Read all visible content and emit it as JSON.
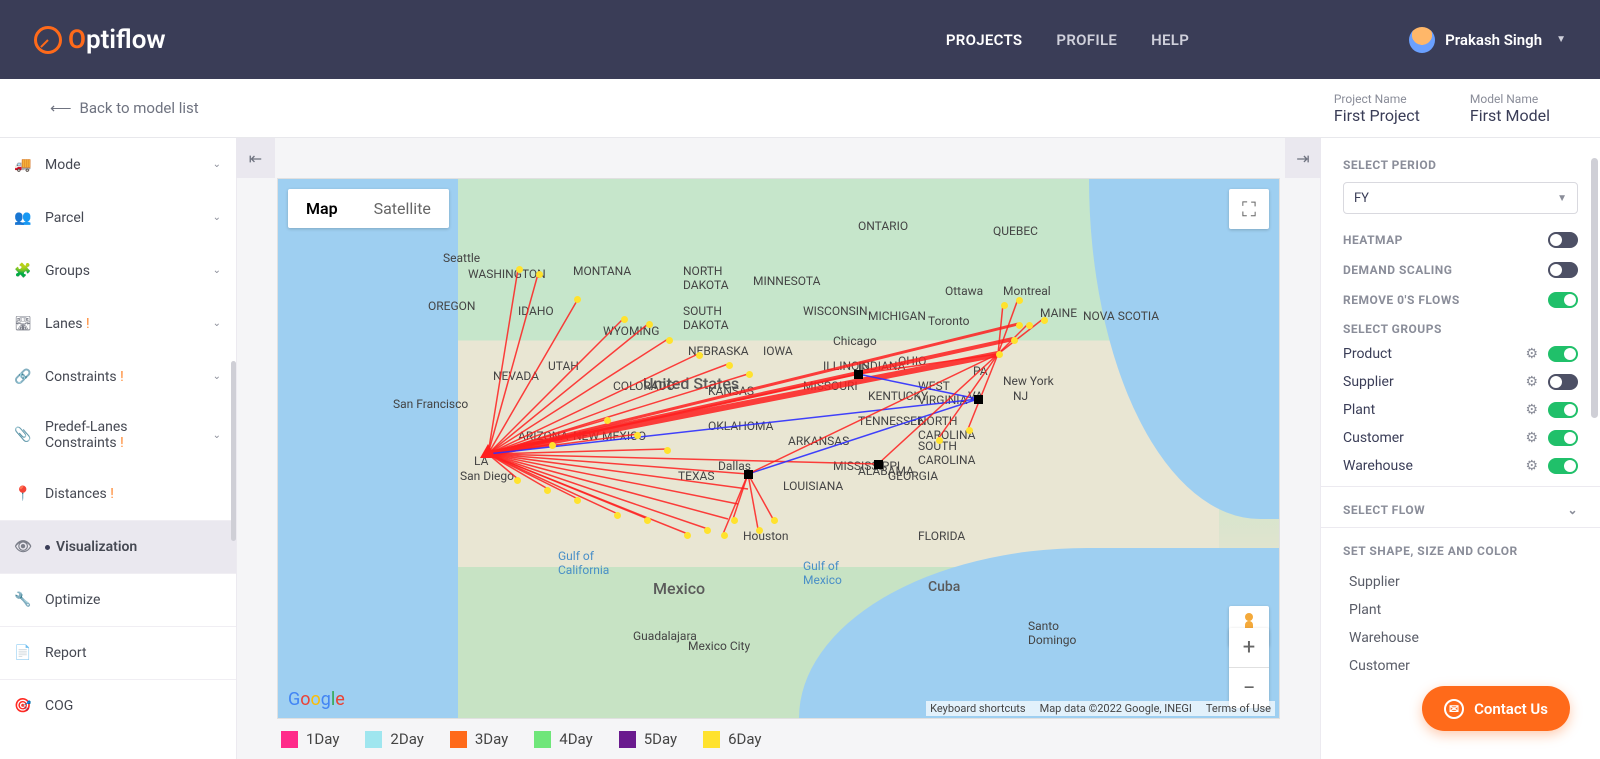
{
  "header": {
    "logo_o": "O",
    "logo_rest": "ptiflow",
    "nav": {
      "projects": "PROJECTS",
      "profile": "PROFILE",
      "help": "HELP"
    },
    "user_name": "Prakash Singh"
  },
  "subheader": {
    "back": "Back to model list",
    "project_label": "Project Name",
    "project_value": "First Project",
    "model_label": "Model Name",
    "model_value": "First Model"
  },
  "sidebar": {
    "items": [
      {
        "icon": "truck",
        "label": "Mode",
        "caret": true
      },
      {
        "icon": "users",
        "label": "Parcel",
        "caret": true
      },
      {
        "icon": "puzzle",
        "label": "Groups",
        "caret": true
      },
      {
        "icon": "route",
        "label": "Lanes",
        "warn": "!",
        "caret": true
      },
      {
        "icon": "link",
        "label": "Constraints",
        "warn": "!",
        "caret": true
      },
      {
        "icon": "clip",
        "label_line1": "Predef-Lanes",
        "label_line2": "Constraints",
        "warn": "!",
        "caret": true,
        "tall": true
      },
      {
        "icon": "pin",
        "label": "Distances",
        "warn": "!"
      },
      {
        "icon": "eye",
        "label": "Visualization",
        "active": true,
        "dot": true
      },
      {
        "icon": "wrench",
        "label": "Optimize"
      },
      {
        "icon": "doc",
        "label": "Report"
      },
      {
        "icon": "target",
        "label": "COG"
      }
    ]
  },
  "map": {
    "type_map": "Map",
    "type_sat": "Satellite",
    "attr_shortcuts": "Keyboard shortcuts",
    "attr_data": "Map data ©2022 Google, INEGI",
    "attr_terms": "Terms of Use",
    "country_us": "United States",
    "country_mx": "Mexico",
    "country_cu": "Cuba",
    "cities": {
      "seattle": "Seattle",
      "washington": "WASHINGTON",
      "oregon": "OREGON",
      "sf": "San Francisco",
      "la": "LA",
      "sandiego": "San Diego",
      "nevada": "NEVADA",
      "utah": "UTAH",
      "idaho": "IDAHO",
      "montana": "MONTANA",
      "ndakota": "NORTH\nDAKOTA",
      "sdakota": "SOUTH\nDAKOTA",
      "nebraska": "NEBRASKA",
      "wyoming": "WYOMING",
      "colorado": "COLORADO",
      "kansas": "KANSAS",
      "oklahoma": "OKLAHOMA",
      "nm": "NEW MEXICO",
      "az": "ARIZONA",
      "tx": "TEXAS",
      "houston": "Houston",
      "dallas": "Dallas",
      "mn": "MINNESOTA",
      "wi": "WISCONSIN",
      "ia": "IOWA",
      "mo": "MISSOURI",
      "ar": "ARKANSAS",
      "la_s": "LOUISIANA",
      "ms": "MISSISSIPPI",
      "al": "ALABAMA",
      "ga": "GEORGIA",
      "fl": "FLORIDA",
      "sc": "SOUTH\nCAROLINA",
      "nc": "NORTH\nCAROLINA",
      "tn": "TENNESSEE",
      "ky": "KENTUCKY",
      "wv": "WEST\nVIRGINIA",
      "va": "VA",
      "oh": "OHIO",
      "in": "INDIANA",
      "il": "ILLINOIS",
      "mi": "MICHIGAN",
      "chicago": "Chicago",
      "ny": "New York",
      "nj": "NJ",
      "pa": "PA",
      "me": "MAINE",
      "ontario": "ONTARIO",
      "quebec": "QUEBEC",
      "ottawa": "Ottawa",
      "montreal": "Montreal",
      "toronto": "Toronto",
      "novascotia": "NOVA SCOTIA",
      "guadalajara": "Guadalajara",
      "mexcity": "Mexico City",
      "santod": "Santo\nDomingo",
      "gulfca": "Gulf of\nCalifornia",
      "gulfmx": "Gulf of\nMexico"
    }
  },
  "legend": [
    {
      "color": "#ff2a8a",
      "label": "1Day"
    },
    {
      "color": "#9fe6ef",
      "label": "2Day"
    },
    {
      "color": "#ff6a1a",
      "label": "3Day"
    },
    {
      "color": "#6fe67a",
      "label": "4Day"
    },
    {
      "color": "#6a1a8e",
      "label": "5Day"
    },
    {
      "color": "#ffe22e",
      "label": "6Day"
    }
  ],
  "rpanel": {
    "select_period": "SELECT PERIOD",
    "period_value": "FY",
    "heatmap": "HEATMAP",
    "demand_scaling": "DEMAND SCALING",
    "remove_zero": "REMOVE 0'S FLOWS",
    "select_groups": "SELECT GROUPS",
    "groups": [
      {
        "name": "Product",
        "on": true
      },
      {
        "name": "Supplier",
        "on": false
      },
      {
        "name": "Plant",
        "on": true
      },
      {
        "name": "Customer",
        "on": true
      },
      {
        "name": "Warehouse",
        "on": true
      }
    ],
    "select_flow": "SELECT FLOW",
    "set_shape": "SET SHAPE, SIZE AND COLOR",
    "shape_items": [
      "Supplier",
      "Plant",
      "Warehouse",
      "Customer"
    ]
  },
  "contact": "Contact Us"
}
